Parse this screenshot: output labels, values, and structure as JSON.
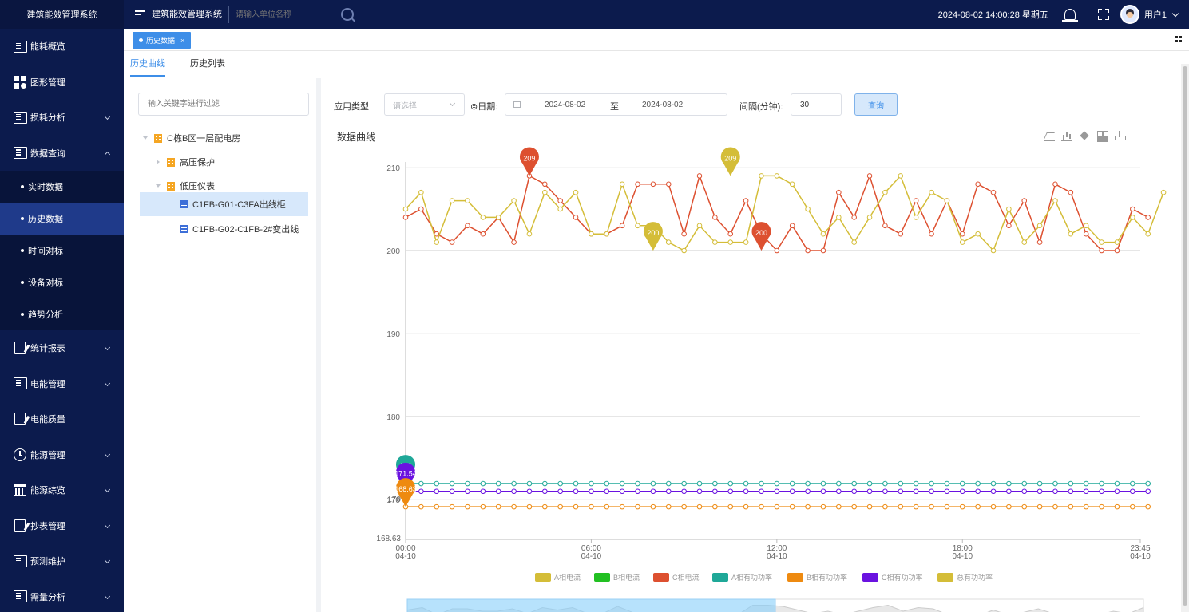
{
  "app": {
    "brand": "建筑能效管理系统",
    "system_title": "建筑能效管理系统",
    "unit_search_placeholder": "请输入单位名称",
    "datetime": "2024-08-02 14:00:28 星期五",
    "username": "用户1"
  },
  "sidebar": {
    "items": [
      {
        "label": "能耗概览",
        "icon": "dashboard-icon",
        "has_arrow": false
      },
      {
        "label": "图形管理",
        "icon": "grid-icon",
        "has_arrow": false
      },
      {
        "label": "损耗分析",
        "icon": "loss-analysis-icon",
        "has_arrow": true
      },
      {
        "label": "数据查询",
        "icon": "data-query-icon",
        "has_arrow": true,
        "expanded": true
      },
      {
        "label": "统计报表",
        "icon": "report-icon",
        "has_arrow": true
      },
      {
        "label": "电能管理",
        "icon": "power-icon",
        "has_arrow": true
      },
      {
        "label": "电能质量",
        "icon": "quality-icon",
        "has_arrow": false
      },
      {
        "label": "能源管理",
        "icon": "clock-icon",
        "has_arrow": true
      },
      {
        "label": "能源综览",
        "icon": "pillar-icon",
        "has_arrow": true
      },
      {
        "label": "抄表管理",
        "icon": "meter-reading-icon",
        "has_arrow": true
      },
      {
        "label": "预测维护",
        "icon": "forecast-icon",
        "has_arrow": true
      },
      {
        "label": "需量分析",
        "icon": "demand-icon",
        "has_arrow": true
      }
    ],
    "sub_items": [
      "实时数据",
      "历史数据",
      "时间对标",
      "设备对标",
      "趋势分析"
    ],
    "active_sub_item": "历史数据"
  },
  "tabs": {
    "page_tab": "历史数据",
    "sub_tabs": [
      "历史曲线",
      "历史列表"
    ],
    "active_sub_tab": "历史曲线"
  },
  "tree": {
    "filter_placeholder": "输入关键字进行过滤",
    "root": "C栋B区一层配电房",
    "groups": [
      "高压保护",
      "低压仪表"
    ],
    "leaves": [
      "C1FB-G01-C3FA出线柜",
      "C1FB-G02-C1FB-2#变出线"
    ],
    "selected": "C1FB-G01-C3FA出线柜"
  },
  "query": {
    "app_type_label": "应用类型",
    "app_type_placeholder": "请选择",
    "date_label": "⊜日期:",
    "date_start": "2024-08-02",
    "date_separator": "至",
    "date_end": "2024-08-02",
    "interval_label": "间隔(分钟):",
    "interval_value": "30",
    "search_button": "查询"
  },
  "chart_data": {
    "type": "line",
    "title": "数据曲线",
    "ylim": [
      168.63,
      210
    ],
    "y_ticks": [
      210,
      200,
      190,
      180,
      170
    ],
    "y_min_label": "168.63",
    "x_tick_labels": [
      {
        "time": "00:00",
        "date": "04-10",
        "index": 0
      },
      {
        "time": "06:00",
        "date": "04-10",
        "index": 12
      },
      {
        "time": "12:00",
        "date": "04-10",
        "index": 24
      },
      {
        "time": "18:00",
        "date": "04-10",
        "index": 36
      },
      {
        "time": "23:45",
        "date": "04-10",
        "index": 47.5
      }
    ],
    "x_count": 48,
    "series": [
      {
        "name": "A相电流",
        "color": "#d4bd38",
        "values": []
      },
      {
        "name": "B相电流",
        "color": "#22c022",
        "values": []
      },
      {
        "name": "C相电流",
        "color": "#dd5030",
        "values": [
          204,
          205,
          202,
          201,
          203,
          202,
          204,
          201,
          209,
          208,
          206,
          204,
          202,
          202,
          203,
          208,
          208,
          208,
          202,
          209,
          204,
          202,
          206,
          202,
          200,
          203,
          200,
          200,
          207,
          204,
          209,
          203,
          202,
          206,
          202,
          206,
          202,
          208,
          207,
          203,
          206,
          201,
          208,
          207,
          202,
          200,
          200,
          205,
          204
        ]
      },
      {
        "name": "A相有功功率",
        "color": "#1fa898",
        "values": [
          173,
          173,
          173,
          173,
          173,
          173,
          173,
          173,
          173,
          173,
          173,
          173,
          173,
          173,
          173,
          173,
          173,
          173,
          173,
          173,
          173,
          173,
          173,
          173,
          173,
          173,
          173,
          173,
          173,
          173,
          173,
          173,
          173,
          173,
          173,
          173,
          173,
          173,
          173,
          173,
          173,
          173,
          173,
          173,
          173,
          173,
          173,
          173,
          173
        ]
      },
      {
        "name": "B相有功功率",
        "color": "#ee8a10",
        "values": [
          168.63,
          168.63,
          168.63,
          168.63,
          168.63,
          168.63,
          168.63,
          168.63,
          168.63,
          168.63,
          168.63,
          168.63,
          168.63,
          168.63,
          168.63,
          168.63,
          168.63,
          168.63,
          168.63,
          168.63,
          168.63,
          168.63,
          168.63,
          168.63,
          168.63,
          168.63,
          168.63,
          168.63,
          168.63,
          168.63,
          168.63,
          168.63,
          168.63,
          168.63,
          168.63,
          168.63,
          168.63,
          168.63,
          168.63,
          168.63,
          168.63,
          168.63,
          168.63,
          168.63,
          168.63,
          168.63,
          168.63,
          168.63,
          168.63
        ]
      },
      {
        "name": "C相有功功率",
        "color": "#6a12e0",
        "values": [
          171.54,
          171.54,
          171.54,
          171.54,
          171.54,
          171.54,
          171.54,
          171.54,
          171.54,
          171.54,
          171.54,
          171.54,
          171.54,
          171.54,
          171.54,
          171.54,
          171.54,
          171.54,
          171.54,
          171.54,
          171.54,
          171.54,
          171.54,
          171.54,
          171.54,
          171.54,
          171.54,
          171.54,
          171.54,
          171.54,
          171.54,
          171.54,
          171.54,
          171.54,
          171.54,
          171.54,
          171.54,
          171.54,
          171.54,
          171.54,
          171.54,
          171.54,
          171.54,
          171.54,
          171.54,
          171.54,
          171.54,
          171.54,
          171.54
        ]
      },
      {
        "name": "总有功功率",
        "color": "#d4bd38",
        "values": [
          205,
          207,
          201,
          206,
          206,
          204,
          204,
          206,
          202,
          207,
          205,
          207,
          202,
          202,
          208,
          203,
          203,
          201,
          200,
          203,
          201,
          201,
          201,
          209,
          209,
          208,
          205,
          202,
          204,
          201,
          204,
          207,
          209,
          204,
          207,
          206,
          201,
          202,
          200,
          205,
          201,
          203,
          206,
          202,
          203,
          201,
          201,
          204,
          202,
          207
        ]
      }
    ],
    "markers": [
      {
        "label": "209",
        "series": "C相电流",
        "index": 8,
        "value": 209
      },
      {
        "label": "200",
        "series": "C相电流",
        "index": 23,
        "value": 200
      },
      {
        "label": "209",
        "series": "总有功功率",
        "index": 21,
        "value": 209
      },
      {
        "label": "200",
        "series": "总有功功率",
        "index": 16,
        "value": 200
      },
      {
        "label": "173",
        "series": "A相有功功率",
        "index": 0,
        "value": 173
      },
      {
        "label": "171.54",
        "series": "C相有功功率",
        "index": 0,
        "value": 171.54
      },
      {
        "label": "168.63",
        "series": "B相有功功率",
        "index": 0,
        "value": 168.63
      }
    ],
    "y_cut_label": "170",
    "legend_position": "bottom",
    "data_zoom_range": [
      0,
      50
    ]
  }
}
